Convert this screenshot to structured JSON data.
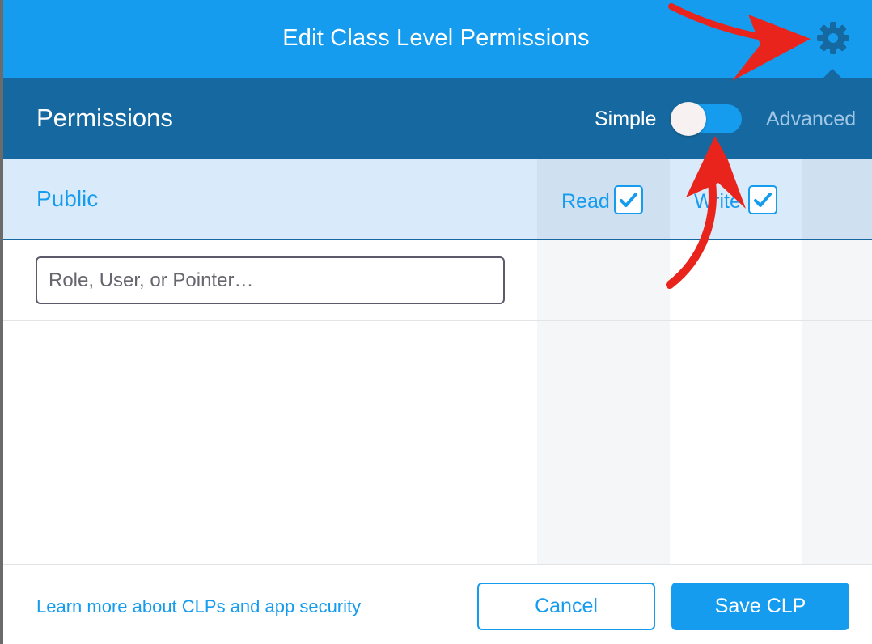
{
  "header": {
    "title": "Edit Class Level Permissions",
    "settings_icon": "gear-icon"
  },
  "permissions_bar": {
    "title": "Permissions",
    "mode_simple": "Simple",
    "mode_advanced": "Advanced",
    "toggle_state": "simple"
  },
  "public_row": {
    "label": "Public",
    "read_label": "Read",
    "read_checked": true,
    "write_label": "Write",
    "write_checked": true
  },
  "entity_input": {
    "placeholder": "Role, User, or Pointer…",
    "value": ""
  },
  "footer": {
    "learn_link": "Learn more about CLPs and app security",
    "cancel_label": "Cancel",
    "save_label": "Save CLP"
  },
  "colors": {
    "primary": "#169cee",
    "dark_bar": "#1669a0",
    "public_bg": "#d9eafa",
    "annotation_arrow": "#e8241c"
  }
}
